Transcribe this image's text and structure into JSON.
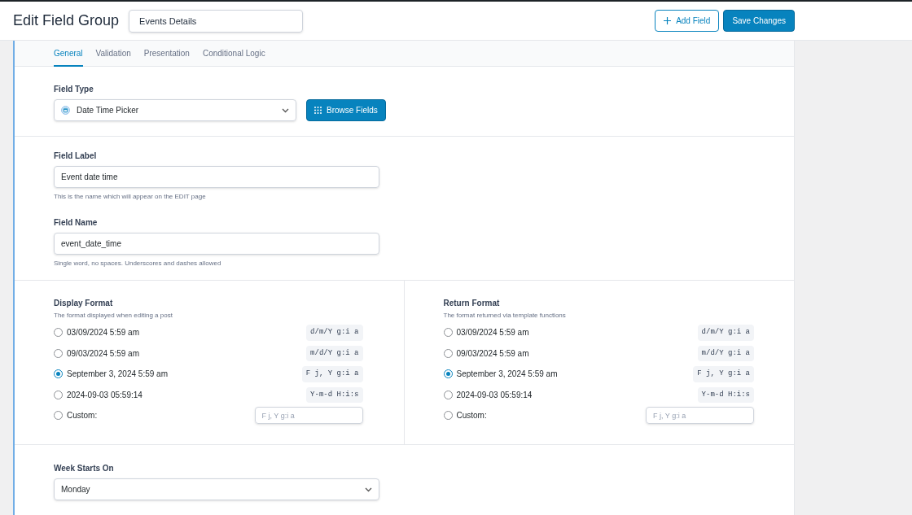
{
  "header": {
    "title": "Edit Field Group",
    "group_name": "Events Details",
    "buttons": [
      {
        "label": "Add Field",
        "kind": "secondary"
      },
      {
        "label": "Save Changes",
        "kind": "primary"
      }
    ]
  },
  "tabs": [
    {
      "label": "General",
      "selected": true
    },
    {
      "label": "Validation",
      "selected": false
    },
    {
      "label": "Presentation",
      "selected": false
    },
    {
      "label": "Conditional Logic",
      "selected": false
    }
  ],
  "field_type": {
    "label": "Field Type",
    "value": "Date Time Picker",
    "browse_button": "Browse Fields"
  },
  "field_label": {
    "label": "Field Label",
    "value": "Event date time",
    "hint": "This is the name which will appear on the EDIT page"
  },
  "field_name": {
    "label": "Field Name",
    "value": "event_date_time",
    "hint": "Single word, no spaces. Underscores and dashes allowed"
  },
  "formats": [
    {
      "label": "Display Format",
      "description": "The format displayed when editing a post",
      "options": [
        {
          "kind": "preset",
          "label": "03/09/2024 5:59 am",
          "code": "d/m/Y g:i a",
          "selected": false
        },
        {
          "kind": "preset",
          "label": "09/03/2024 5:59 am",
          "code": "m/d/Y g:i a",
          "selected": false
        },
        {
          "kind": "preset",
          "label": "September 3, 2024 5:59 am",
          "code": "F j, Y g:i a",
          "selected": true
        },
        {
          "kind": "preset",
          "label": "2024-09-03 05:59:14",
          "code": "Y-m-d H:i:s",
          "selected": false
        },
        {
          "kind": "custom",
          "label": "Custom:",
          "placeholder": "F j, Y g:i a",
          "selected": false
        }
      ]
    },
    {
      "label": "Return Format",
      "description": "The format returned via template functions",
      "options": [
        {
          "kind": "preset",
          "label": "03/09/2024 5:59 am",
          "code": "d/m/Y g:i a",
          "selected": false
        },
        {
          "kind": "preset",
          "label": "09/03/2024 5:59 am",
          "code": "m/d/Y g:i a",
          "selected": false
        },
        {
          "kind": "preset",
          "label": "September 3, 2024 5:59 am",
          "code": "F j, Y g:i a",
          "selected": true
        },
        {
          "kind": "preset",
          "label": "2024-09-03 05:59:14",
          "code": "Y-m-d H:i:s",
          "selected": false
        },
        {
          "kind": "custom",
          "label": "Custom:",
          "placeholder": "F j, Y g:i a",
          "selected": false
        }
      ]
    }
  ],
  "week_starts_on": {
    "label": "Week Starts On",
    "value": "Monday"
  }
}
